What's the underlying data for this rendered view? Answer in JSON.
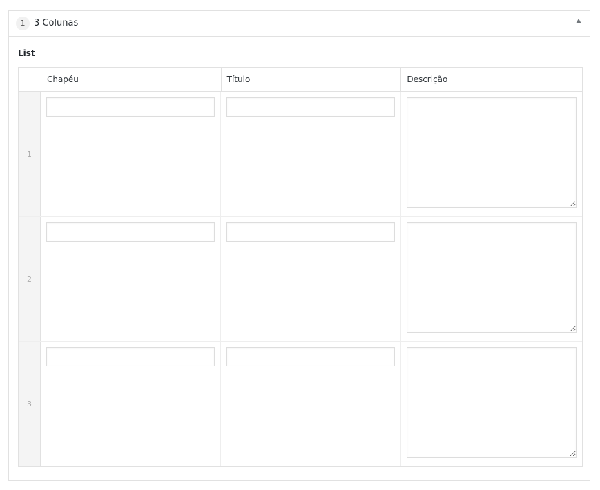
{
  "layout": {
    "order": "1",
    "title": "3 Colunas"
  },
  "field": {
    "label": "List"
  },
  "columns": [
    "Chapéu",
    "Título",
    "Descrição"
  ],
  "rows": [
    {
      "num": "1",
      "chapeu": "",
      "titulo": "",
      "descricao": ""
    },
    {
      "num": "2",
      "chapeu": "",
      "titulo": "",
      "descricao": ""
    },
    {
      "num": "3",
      "chapeu": "",
      "titulo": "",
      "descricao": ""
    }
  ],
  "icons": {
    "toggle": "collapse-arrow-up-icon"
  }
}
